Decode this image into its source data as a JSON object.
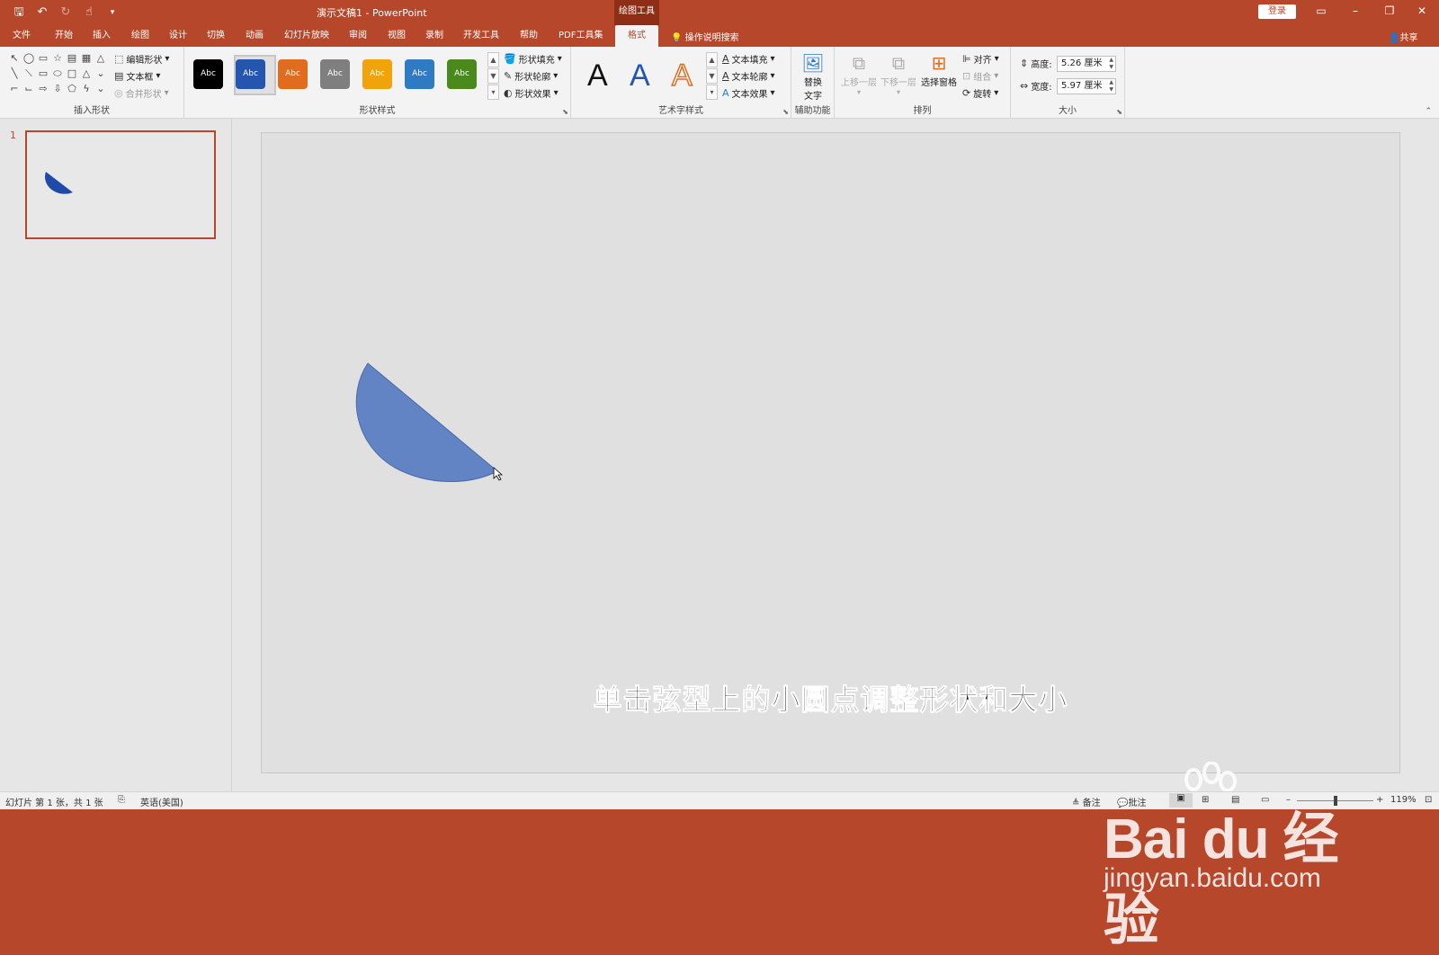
{
  "titlebar": {
    "doc_title": "演示文稿1  -  PowerPoint",
    "context_tab": "绘图工具",
    "login": "登录"
  },
  "tabs": [
    {
      "label": "文件"
    },
    {
      "label": "开始"
    },
    {
      "label": "插入"
    },
    {
      "label": "绘图"
    },
    {
      "label": "设计"
    },
    {
      "label": "切换"
    },
    {
      "label": "动画"
    },
    {
      "label": "幻灯片放映"
    },
    {
      "label": "审阅"
    },
    {
      "label": "视图"
    },
    {
      "label": "录制"
    },
    {
      "label": "开发工具"
    },
    {
      "label": "帮助"
    },
    {
      "label": "PDF工具集"
    },
    {
      "label": "格式",
      "active": true
    }
  ],
  "tell_me": "操作说明搜索",
  "share": "共享",
  "ribbon": {
    "insert_shapes": {
      "label": "插入形状",
      "edit_shape": "编辑形状",
      "text_box": "文本框",
      "merge_shapes": "合并形状"
    },
    "shape_styles": {
      "label": "形状样式",
      "swatch_text": "Abc",
      "swatches": [
        {
          "color": "#000000"
        },
        {
          "color": "#2456b0"
        },
        {
          "color": "#e26c1e"
        },
        {
          "color": "#7f7f7f"
        },
        {
          "color": "#f0a30a"
        },
        {
          "color": "#2e7bc4"
        },
        {
          "color": "#4a8a1c"
        }
      ],
      "fill": "形状填充",
      "outline": "形状轮廓",
      "effects": "形状效果"
    },
    "wordart": {
      "label": "艺术字样式",
      "letter": "A",
      "text_fill": "文本填充",
      "text_outline": "文本轮廓",
      "text_effects": "文本效果"
    },
    "accessibility": {
      "label": "辅助功能",
      "alt_text_1": "替换",
      "alt_text_2": "文字"
    },
    "arrange": {
      "label": "排列",
      "bring_forward": "上移一层",
      "send_backward": "下移一层",
      "selection_pane": "选择窗格",
      "align": "对齐",
      "group": "组合",
      "rotate": "旋转"
    },
    "size": {
      "label": "大小",
      "height_label": "高度:",
      "height": "5.26 厘米",
      "width_label": "宽度:",
      "width": "5.97 厘米"
    }
  },
  "thumbnail": {
    "number": "1"
  },
  "slide": {
    "caption": "单击弦型上的小圆点调整形状和大小",
    "shape_color": "#6384c4",
    "thumb_shape_color": "#1f4aa8"
  },
  "watermark": {
    "brand": "Bai du 经验",
    "url": "jingyan.baidu.com"
  },
  "statusbar": {
    "slide_info": "幻灯片 第 1 张，共 1 张",
    "language": "英语(美国)",
    "notes": "备注",
    "comments": "批注",
    "zoom": "119%"
  }
}
